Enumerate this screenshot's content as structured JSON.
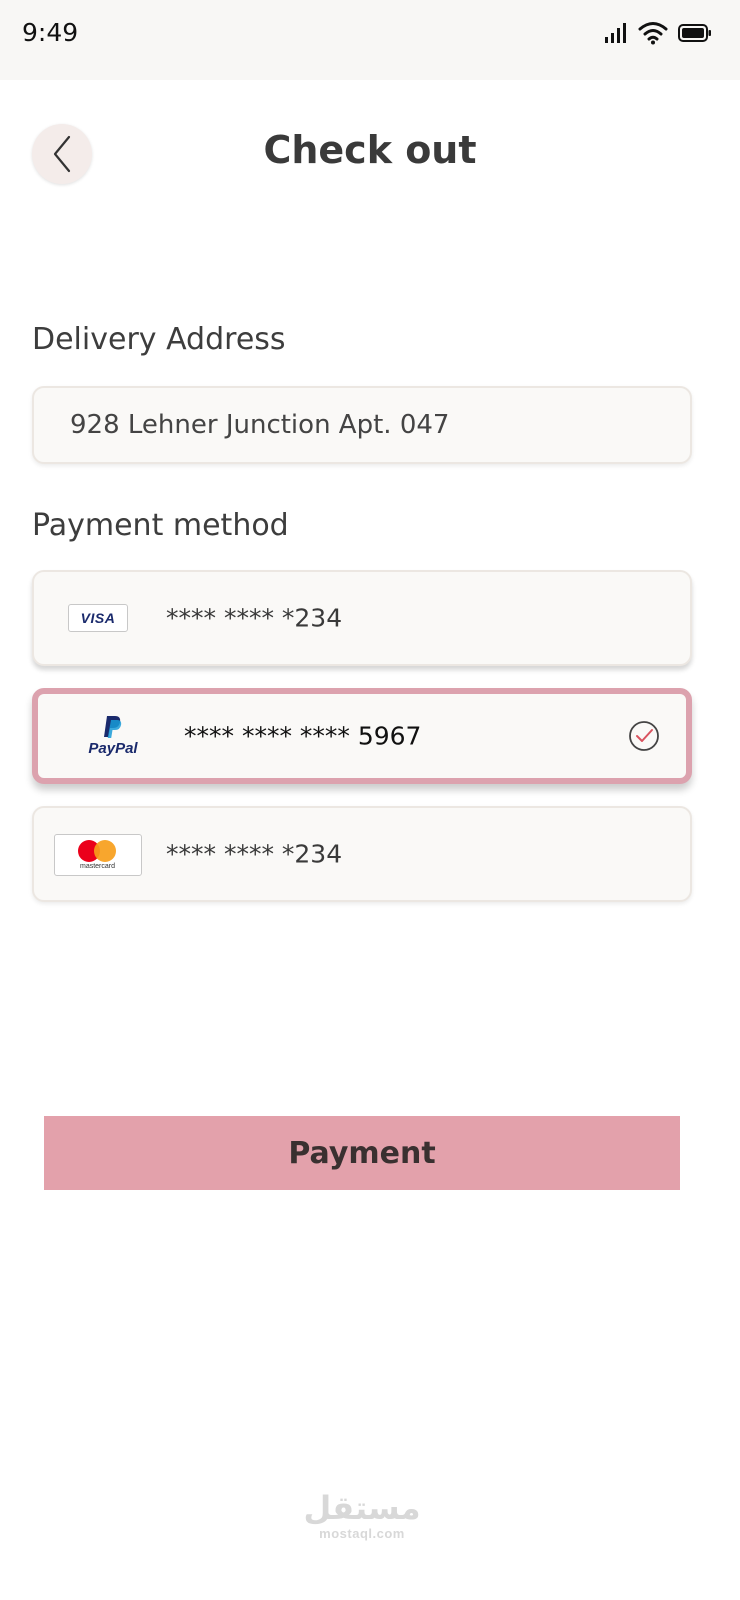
{
  "status_bar": {
    "time": "9:49",
    "icons": [
      "signal-icon",
      "wifi-icon",
      "battery-icon"
    ]
  },
  "header": {
    "back_icon": "chevron-left-icon",
    "title": "Check out"
  },
  "delivery": {
    "label": "Delivery Address",
    "address_value": "928 Lehner Junction Apt. 047"
  },
  "payment": {
    "label": "Payment method",
    "methods": [
      {
        "brand": "visa",
        "brand_text": "VISA",
        "number": "**** **** *234",
        "selected": false
      },
      {
        "brand": "paypal",
        "brand_text": "PayPal",
        "number": "**** **** **** 5967",
        "selected": true
      },
      {
        "brand": "mastercard",
        "brand_text": "mastercard",
        "number": "**** **** *234",
        "selected": false
      }
    ],
    "selected_icon": "check-circle-icon"
  },
  "actions": {
    "payment_label": "Payment"
  },
  "watermark": {
    "arabic": "مستقل",
    "latin": "mostaql.com"
  },
  "colors": {
    "accent": "#e3a1ab",
    "selected_border": "#dca2ae",
    "check": "#d9535f",
    "paypal_dark": "#1a2a6c",
    "paypal_light": "#179bd7",
    "mc_red": "#eb001b",
    "mc_orange": "#f79e1b"
  }
}
